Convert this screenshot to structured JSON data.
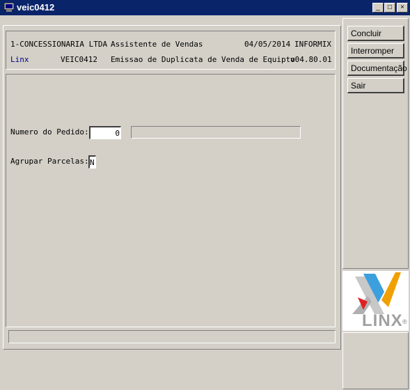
{
  "window": {
    "title": "veic0412",
    "minimize_glyph": "_",
    "maximize_glyph": "□",
    "close_glyph": "×"
  },
  "header": {
    "company": "1-CONCESSIONARIA LTDA",
    "module": "Assistente de Vendas",
    "date": "04/05/2014",
    "db": "INFORMIX",
    "brand": "Linx",
    "program": "VEIC0412",
    "description": "Emissao de Duplicata de Venda de Equipto",
    "version": "v04.80.01"
  },
  "form": {
    "pedido_label": "Numero do Pedido:",
    "pedido_value": "0",
    "pedido_desc": "",
    "agrupar_label": "Agrupar Parcelas:",
    "agrupar_value": "N"
  },
  "status": {
    "message": ""
  },
  "actions": {
    "concluir": "Concluir",
    "interromper": "Interromper",
    "documentacao": "Documentação",
    "sair": "Sair"
  },
  "logo": {
    "text": "LINX",
    "mark": "®"
  },
  "colors": {
    "titlebar": "#0a246a",
    "brand_link": "#000080",
    "face": "#d4d0c8",
    "logo_orange": "#f0a000",
    "logo_red": "#e02020",
    "logo_blue": "#1a8fd8"
  }
}
